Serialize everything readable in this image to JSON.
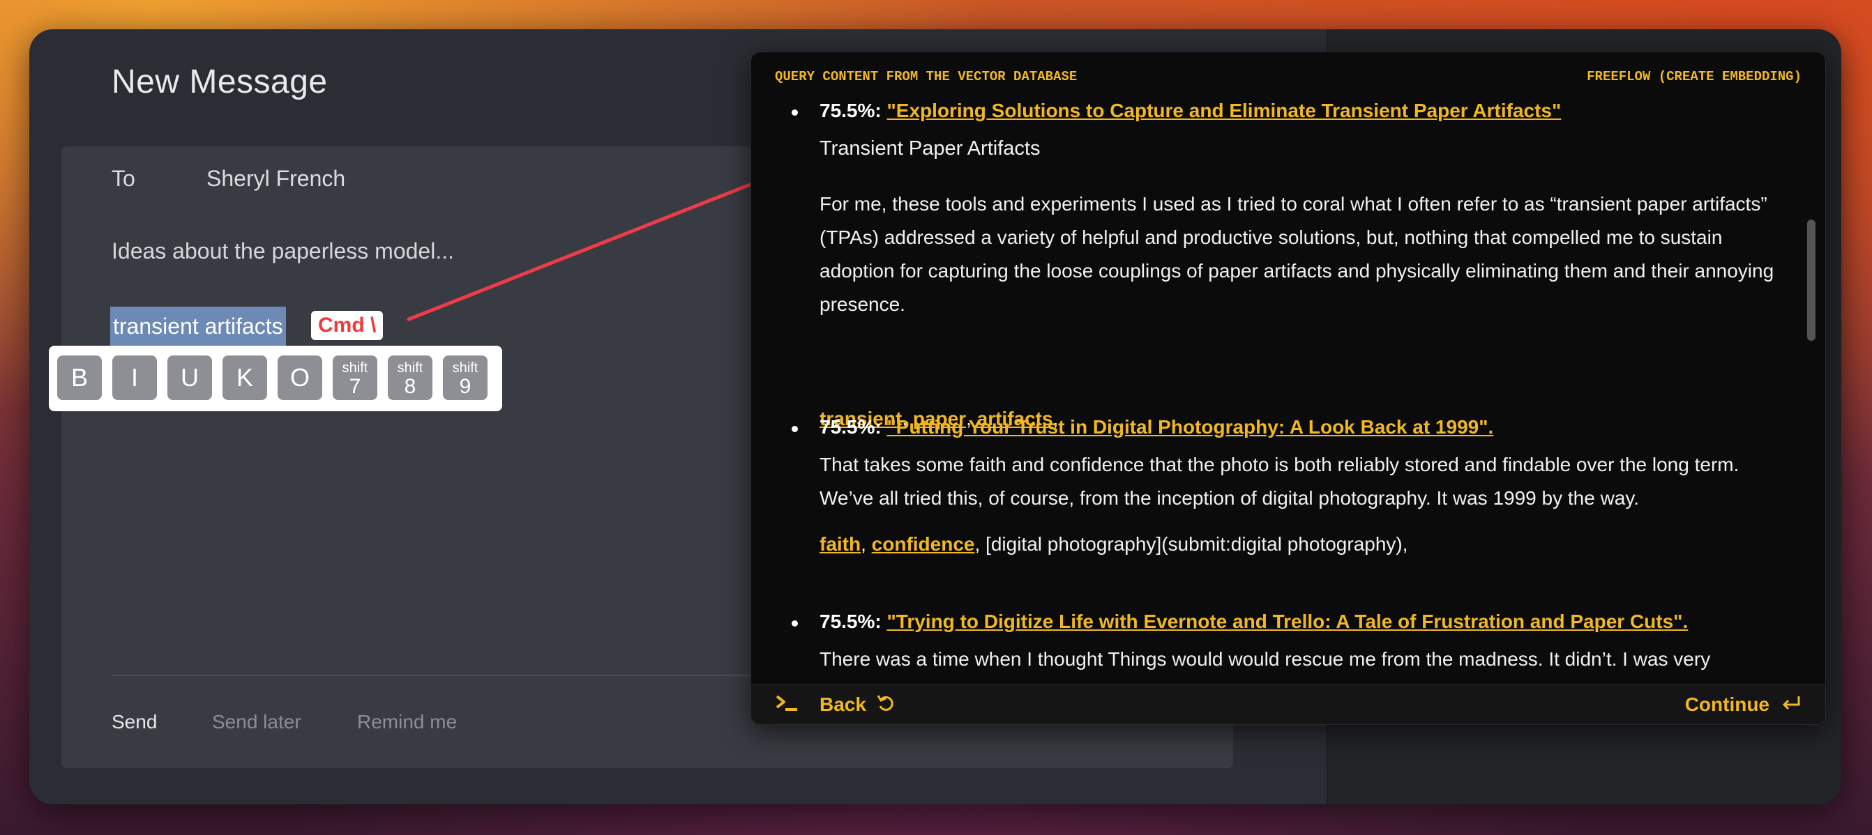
{
  "compose": {
    "title": "New Message",
    "to_label": "To",
    "to_value": "Sheryl French",
    "subject": "Ideas about the paperless model...",
    "selected_text": "transient artifacts",
    "shortcut": "Cmd \\",
    "format_buttons": [
      "B",
      "I",
      "U",
      "K",
      "O"
    ],
    "shift_buttons": [
      {
        "top": "shift",
        "key": "7"
      },
      {
        "top": "shift",
        "key": "8"
      },
      {
        "top": "shift",
        "key": "9"
      }
    ],
    "footer": {
      "send": "Send",
      "send_later": "Send later",
      "remind": "Remind me"
    }
  },
  "panel": {
    "header_left": "QUERY CONTENT FROM THE VECTOR DATABASE",
    "header_right": "FREEFLOW (CREATE EMBEDDING)",
    "results": [
      {
        "score": "75.5%:",
        "title": "\"Exploring Solutions to Capture and Eliminate Transient Paper Artifacts\"",
        "subtitle": "Transient Paper Artifacts",
        "body": "For me, these tools and experiments I used as I tried to coral what I often refer to as “transient paper artifacts” (TPAs) addressed a variety of helpful and productive solutions, but, nothing that compelled me to sustain adoption for capturing the loose couplings of paper artifacts and physically eliminating them and their annoying presence.",
        "tags": [
          "transient",
          "paper",
          "artifacts"
        ],
        "tags_tail": ","
      },
      {
        "score": "75.5%:",
        "title": "\"Putting Your Trust in Digital Photography: A Look Back at 1999\".",
        "body": "That takes some faith and confidence that the photo is both reliably stored and findable over the long term. We’ve all tried this, of course, from the inception of digital photography. It was 1999 by the way.",
        "tags": [
          "faith",
          "confidence"
        ],
        "tags_tail": ", [digital photography](submit:digital photography),"
      },
      {
        "score": "75.5%:",
        "title": "\"Trying to Digitize Life with Evernote and Trello: A Tale of Frustration and Paper Cuts\".",
        "body": "There was a time when I thought Things would would rescue me from the madness. It didn’t. I was very"
      }
    ],
    "footer": {
      "back": "Back",
      "continue": "Continue"
    }
  },
  "colors": {
    "accent": "#f2b81f",
    "arrow": "#ef3b4a",
    "selection": "#6c8ab5"
  },
  "icons": [
    "terminal-icon",
    "undo-icon",
    "enter-icon"
  ]
}
